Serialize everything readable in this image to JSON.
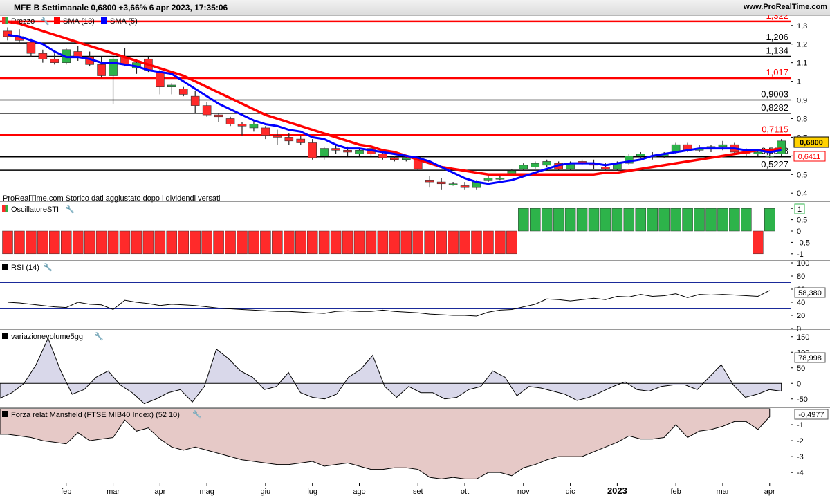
{
  "header": {
    "title": "MFE B Settimanale 0,6800 +3,66% 6 apr 2023, 17:35:06",
    "site": "www.ProRealTime.com"
  },
  "colors": {
    "up": "#2db34a",
    "down": "#ff2a2a",
    "sma13": "#ff0000",
    "sma5": "#0000ff",
    "price_tag": "#ffd200"
  },
  "chart_data": [
    {
      "type": "candlestick",
      "panel": "price",
      "legend": [
        "Prezzo",
        "SMA (13)",
        "SMA (5)"
      ],
      "note": "ProRealTime.com  Storico dati aggiustato dopo i dividendi versati",
      "ylim": [
        0.36,
        1.34
      ],
      "y_ticks": [
        0.4,
        0.5,
        0.6,
        0.7,
        0.8,
        0.9,
        1,
        1.1,
        1.2,
        1.3
      ],
      "y_tick_labels": [
        "0,4",
        "0,5",
        "0,6",
        "0,7",
        "0,8",
        "0,9",
        "1",
        "1,1",
        "1,2",
        "1,3"
      ],
      "x_labels": [
        {
          "label": "feb",
          "week": 5
        },
        {
          "label": "mar",
          "week": 9
        },
        {
          "label": "apr",
          "week": 13
        },
        {
          "label": "mag",
          "week": 17
        },
        {
          "label": "giu",
          "week": 22
        },
        {
          "label": "lug",
          "week": 26
        },
        {
          "label": "ago",
          "week": 30
        },
        {
          "label": "set",
          "week": 35
        },
        {
          "label": "ott",
          "week": 39
        },
        {
          "label": "nov",
          "week": 44
        },
        {
          "label": "dic",
          "week": 48
        },
        {
          "label": "2023",
          "week": 52
        },
        {
          "label": "feb",
          "week": 57
        },
        {
          "label": "mar",
          "week": 61
        },
        {
          "label": "apr",
          "week": 65
        }
      ],
      "levels": [
        {
          "value": 1.322,
          "label": "1,322",
          "color": "#ff0000"
        },
        {
          "value": 1.206,
          "label": "1,206",
          "color": "#000000"
        },
        {
          "value": 1.134,
          "label": "1,134",
          "color": "#000000"
        },
        {
          "value": 1.017,
          "label": "1,017",
          "color": "#ff0000"
        },
        {
          "value": 0.9003,
          "label": "0,9003",
          "color": "#000000"
        },
        {
          "value": 0.8282,
          "label": "0,8282",
          "color": "#000000"
        },
        {
          "value": 0.7115,
          "label": "0,7115",
          "color": "#ff0000"
        },
        {
          "value": 0.5948,
          "label": "0,5948",
          "color": "#000000"
        },
        {
          "value": 0.5227,
          "label": "0,5227",
          "color": "#000000"
        }
      ],
      "last_price": "0,6800",
      "sma13_last": "0,6411",
      "series": [
        {
          "name": "Prezzo",
          "ohlc": [
            [
              1.27,
              1.29,
              1.22,
              1.24
            ],
            [
              1.24,
              1.28,
              1.2,
              1.22
            ],
            [
              1.21,
              1.23,
              1.13,
              1.15
            ],
            [
              1.15,
              1.17,
              1.1,
              1.12
            ],
            [
              1.12,
              1.15,
              1.09,
              1.1
            ],
            [
              1.1,
              1.18,
              1.09,
              1.17
            ],
            [
              1.16,
              1.19,
              1.11,
              1.13
            ],
            [
              1.13,
              1.16,
              1.08,
              1.09
            ],
            [
              1.09,
              1.13,
              1.02,
              1.03
            ],
            [
              1.03,
              1.13,
              0.88,
              1.12
            ],
            [
              1.13,
              1.18,
              1.08,
              1.09
            ],
            [
              1.07,
              1.12,
              1.04,
              1.1
            ],
            [
              1.12,
              1.13,
              1.05,
              1.06
            ],
            [
              1.05,
              1.07,
              0.93,
              0.97
            ],
            [
              0.97,
              0.99,
              0.93,
              0.98
            ],
            [
              0.96,
              0.97,
              0.92,
              0.93
            ],
            [
              0.92,
              0.95,
              0.83,
              0.87
            ],
            [
              0.87,
              0.89,
              0.81,
              0.82
            ],
            [
              0.82,
              0.83,
              0.78,
              0.81
            ],
            [
              0.8,
              0.81,
              0.76,
              0.77
            ],
            [
              0.77,
              0.78,
              0.71,
              0.76
            ],
            [
              0.75,
              0.79,
              0.73,
              0.77
            ],
            [
              0.75,
              0.76,
              0.69,
              0.71
            ],
            [
              0.71,
              0.74,
              0.66,
              0.7
            ],
            [
              0.7,
              0.72,
              0.66,
              0.68
            ],
            [
              0.69,
              0.71,
              0.66,
              0.67
            ],
            [
              0.67,
              0.69,
              0.58,
              0.59
            ],
            [
              0.6,
              0.65,
              0.58,
              0.64
            ],
            [
              0.64,
              0.66,
              0.61,
              0.63
            ],
            [
              0.63,
              0.65,
              0.6,
              0.62
            ],
            [
              0.61,
              0.64,
              0.6,
              0.63
            ],
            [
              0.64,
              0.65,
              0.6,
              0.61
            ],
            [
              0.61,
              0.62,
              0.58,
              0.59
            ],
            [
              0.59,
              0.6,
              0.57,
              0.58
            ],
            [
              0.58,
              0.6,
              0.57,
              0.59
            ],
            [
              0.58,
              0.59,
              0.52,
              0.53
            ],
            [
              0.47,
              0.49,
              0.43,
              0.46
            ],
            [
              0.46,
              0.48,
              0.42,
              0.45
            ],
            [
              0.45,
              0.46,
              0.44,
              0.45
            ],
            [
              0.44,
              0.46,
              0.42,
              0.43
            ],
            [
              0.43,
              0.47,
              0.42,
              0.46
            ],
            [
              0.47,
              0.49,
              0.46,
              0.48
            ],
            [
              0.48,
              0.5,
              0.47,
              0.48
            ],
            [
              0.5,
              0.53,
              0.49,
              0.52
            ],
            [
              0.53,
              0.56,
              0.52,
              0.55
            ],
            [
              0.54,
              0.57,
              0.53,
              0.56
            ],
            [
              0.55,
              0.58,
              0.54,
              0.57
            ],
            [
              0.56,
              0.57,
              0.52,
              0.53
            ],
            [
              0.53,
              0.57,
              0.52,
              0.56
            ],
            [
              0.57,
              0.58,
              0.55,
              0.56
            ],
            [
              0.56,
              0.58,
              0.53,
              0.55
            ],
            [
              0.54,
              0.56,
              0.52,
              0.53
            ],
            [
              0.53,
              0.57,
              0.52,
              0.56
            ],
            [
              0.56,
              0.61,
              0.55,
              0.6
            ],
            [
              0.6,
              0.62,
              0.59,
              0.61
            ],
            [
              0.6,
              0.62,
              0.58,
              0.6
            ],
            [
              0.6,
              0.62,
              0.59,
              0.61
            ],
            [
              0.62,
              0.67,
              0.61,
              0.66
            ],
            [
              0.66,
              0.67,
              0.62,
              0.63
            ],
            [
              0.63,
              0.66,
              0.62,
              0.64
            ],
            [
              0.64,
              0.66,
              0.62,
              0.65
            ],
            [
              0.65,
              0.68,
              0.63,
              0.66
            ],
            [
              0.66,
              0.67,
              0.61,
              0.62
            ],
            [
              0.62,
              0.64,
              0.6,
              0.61
            ],
            [
              0.61,
              0.63,
              0.6,
              0.62
            ],
            [
              0.6,
              0.62,
              0.59,
              0.6
            ],
            [
              0.61,
              0.69,
              0.6,
              0.68
            ]
          ]
        },
        {
          "name": "SMA (13)",
          "values": [
            1.32,
            1.31,
            1.29,
            1.27,
            1.25,
            1.23,
            1.21,
            1.19,
            1.17,
            1.15,
            1.13,
            1.11,
            1.09,
            1.07,
            1.05,
            1.03,
            1.0,
            0.97,
            0.94,
            0.91,
            0.88,
            0.85,
            0.82,
            0.8,
            0.78,
            0.76,
            0.74,
            0.72,
            0.7,
            0.68,
            0.66,
            0.65,
            0.63,
            0.62,
            0.6,
            0.58,
            0.56,
            0.54,
            0.53,
            0.52,
            0.51,
            0.5,
            0.5,
            0.5,
            0.5,
            0.5,
            0.5,
            0.5,
            0.5,
            0.5,
            0.5,
            0.51,
            0.51,
            0.52,
            0.53,
            0.54,
            0.55,
            0.56,
            0.57,
            0.58,
            0.59,
            0.6,
            0.61,
            0.62,
            0.63,
            0.63,
            0.64
          ]
        },
        {
          "name": "SMA (5)",
          "values": [
            1.25,
            1.24,
            1.22,
            1.2,
            1.16,
            1.13,
            1.13,
            1.12,
            1.1,
            1.1,
            1.09,
            1.08,
            1.06,
            1.05,
            1.04,
            1.0,
            0.96,
            0.92,
            0.88,
            0.85,
            0.82,
            0.79,
            0.77,
            0.76,
            0.74,
            0.73,
            0.7,
            0.69,
            0.66,
            0.64,
            0.64,
            0.63,
            0.62,
            0.61,
            0.6,
            0.59,
            0.57,
            0.54,
            0.51,
            0.48,
            0.46,
            0.45,
            0.46,
            0.47,
            0.49,
            0.51,
            0.53,
            0.55,
            0.56,
            0.56,
            0.56,
            0.55,
            0.56,
            0.57,
            0.58,
            0.6,
            0.61,
            0.62,
            0.63,
            0.64,
            0.64,
            0.64,
            0.64,
            0.63,
            0.63,
            0.62,
            0.63
          ]
        }
      ]
    },
    {
      "type": "bar",
      "panel": "oscillator",
      "legend": "OscillatoreSTI",
      "ylim": [
        -1.25,
        1.25
      ],
      "y_ticks": [
        1,
        0.5,
        0,
        -0.5,
        -1
      ],
      "y_tick_labels": [
        "1",
        "0,5",
        "0",
        "-0,5",
        "-1"
      ],
      "last_value": "1",
      "values": [
        -1,
        -1,
        -1,
        -1,
        -1,
        -1,
        -1,
        -1,
        -1,
        -1,
        -1,
        -1,
        -1,
        -1,
        -1,
        -1,
        -1,
        -1,
        -1,
        -1,
        -1,
        -1,
        -1,
        -1,
        -1,
        -1,
        -1,
        -1,
        -1,
        -1,
        -1,
        -1,
        -1,
        -1,
        -1,
        -1,
        -1,
        -1,
        -1,
        -1,
        -1,
        -1,
        -1,
        -1,
        1,
        1,
        1,
        1,
        1,
        1,
        1,
        1,
        1,
        1,
        1,
        1,
        1,
        1,
        1,
        1,
        1,
        1,
        1,
        1,
        -1,
        1
      ]
    },
    {
      "type": "line",
      "panel": "rsi",
      "legend": "RSI (14)",
      "ylim": [
        0,
        100
      ],
      "y_ticks": [
        100,
        80,
        60,
        40,
        20,
        0
      ],
      "y_tick_labels": [
        "100",
        "80",
        "60",
        "40",
        "20",
        "0"
      ],
      "bands": [
        70,
        30
      ],
      "last_value": "58,380",
      "values": [
        40,
        39,
        37,
        35,
        33,
        32,
        40,
        37,
        36,
        29,
        43,
        40,
        38,
        35,
        37,
        36,
        35,
        33,
        31,
        30,
        29,
        28,
        27,
        26,
        26,
        25,
        24,
        23,
        26,
        27,
        26,
        26,
        28,
        26,
        25,
        24,
        22,
        21,
        20,
        20,
        19,
        25,
        28,
        29,
        33,
        37,
        45,
        44,
        42,
        44,
        46,
        44,
        49,
        48,
        52,
        49,
        50,
        53,
        47,
        52,
        51,
        52,
        51,
        50,
        49,
        58
      ]
    },
    {
      "type": "area",
      "panel": "volume",
      "legend": "variazionevolume5gg",
      "ylim": [
        -75,
        165
      ],
      "y_ticks": [
        150,
        100,
        50,
        0,
        -50
      ],
      "y_tick_labels": [
        "150",
        "100",
        "50",
        "0",
        "-50"
      ],
      "last_value": "78,998",
      "values": [
        -48,
        -30,
        0,
        60,
        145,
        45,
        -35,
        -20,
        20,
        40,
        -5,
        -30,
        -65,
        -50,
        -30,
        -20,
        -60,
        -10,
        110,
        80,
        40,
        20,
        -20,
        -10,
        35,
        -30,
        -45,
        -50,
        -35,
        20,
        45,
        90,
        -10,
        -45,
        -10,
        -30,
        -30,
        -50,
        -45,
        -20,
        -10,
        40,
        20,
        -40,
        -10,
        -15,
        -25,
        -35,
        -55,
        -45,
        -28,
        -10,
        5,
        -20,
        -25,
        -10,
        -5,
        -5,
        -20,
        20,
        60,
        -5,
        -45,
        -35,
        -20,
        -25,
        -25,
        -35,
        -15,
        -5,
        90,
        -40,
        -45,
        -20,
        -5,
        -20,
        0,
        -30,
        -20,
        -20,
        -45,
        -15,
        -5,
        -25,
        -25,
        -10,
        -10,
        -10,
        -20,
        -15,
        0,
        -40,
        -35,
        0,
        79
      ],
      "series_limit": 66
    },
    {
      "type": "area",
      "panel": "mansfield",
      "legend": "Forza relat Mansfield (FTSE MIB40 Index) (52 10)",
      "ylim": [
        -4.6,
        0
      ],
      "y_ticks": [
        -1,
        -2,
        -3,
        -4
      ],
      "y_tick_labels": [
        "-1",
        "-2",
        "-3",
        "-4"
      ],
      "last_value": "-0,4977",
      "values": [
        -1.6,
        -1.7,
        -1.8,
        -2.0,
        -2.1,
        -2.2,
        -1.5,
        -2.0,
        -1.9,
        -1.8,
        -0.7,
        -1.4,
        -1.2,
        -1.9,
        -2.4,
        -2.6,
        -2.4,
        -2.6,
        -2.8,
        -3.0,
        -3.2,
        -3.3,
        -3.4,
        -3.5,
        -3.5,
        -3.4,
        -3.3,
        -3.6,
        -3.5,
        -3.4,
        -3.6,
        -3.8,
        -3.8,
        -3.7,
        -3.7,
        -3.8,
        -4.3,
        -4.4,
        -4.3,
        -4.4,
        -4.4,
        -4.0,
        -4.0,
        -4.2,
        -3.7,
        -3.5,
        -3.2,
        -3.0,
        -3.0,
        -3.0,
        -2.7,
        -2.4,
        -2.1,
        -1.7,
        -1.9,
        -1.9,
        -1.8,
        -1.0,
        -1.8,
        -1.4,
        -1.3,
        -1.1,
        -0.8,
        -0.8,
        -1.3,
        -0.5
      ]
    }
  ]
}
